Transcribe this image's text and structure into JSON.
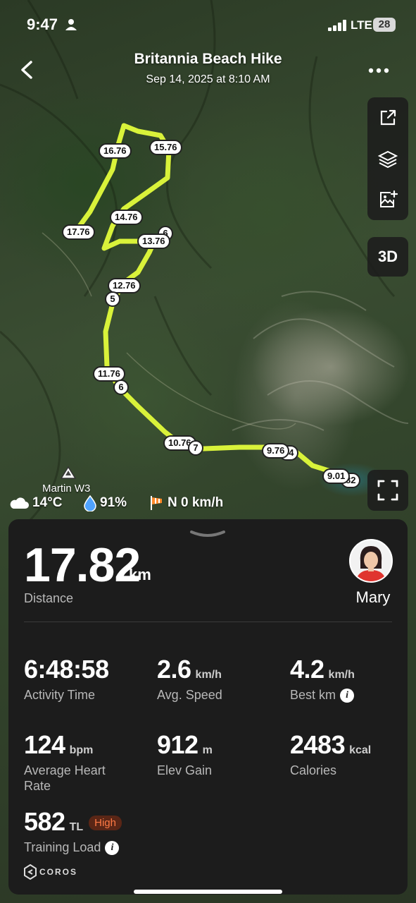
{
  "status_bar": {
    "time": "9:47",
    "network": "LTE",
    "battery": "28"
  },
  "header": {
    "title": "Britannia Beach Hike",
    "subtitle": "Sep 14, 2025 at 8:10 AM"
  },
  "map": {
    "toolbar_3d": "3D",
    "km_markers": [
      "16.76",
      "15.76",
      "14.76",
      "13.76",
      "12.76",
      "11.76",
      "10.76",
      "9.76",
      "9.01",
      "17.76",
      "6",
      "5",
      "6",
      "7",
      "64",
      "82"
    ],
    "peak_name": "Martin W3",
    "weather": {
      "temperature": "14°C",
      "humidity": "91%",
      "wind": "N 0 km/h"
    },
    "route_color": "#d9f23a"
  },
  "summary": {
    "distance_value": "17.82",
    "distance_unit": "km",
    "distance_label": "Distance",
    "user_name": "Mary",
    "stats": [
      {
        "value": "6:48:58",
        "unit": "",
        "label": "Activity Time"
      },
      {
        "value": "2.6",
        "unit": "km/h",
        "label": "Avg. Speed"
      },
      {
        "value": "4.2",
        "unit": "km/h",
        "label": "Best km"
      },
      {
        "value": "124",
        "unit": "bpm",
        "label": "Average Heart Rate"
      },
      {
        "value": "912",
        "unit": "m",
        "label": "Elev Gain"
      },
      {
        "value": "2483",
        "unit": "kcal",
        "label": "Calories"
      },
      {
        "value": "582",
        "unit": "TL",
        "label": "Training Load",
        "badge": "High"
      }
    ],
    "brand": "COROS"
  }
}
